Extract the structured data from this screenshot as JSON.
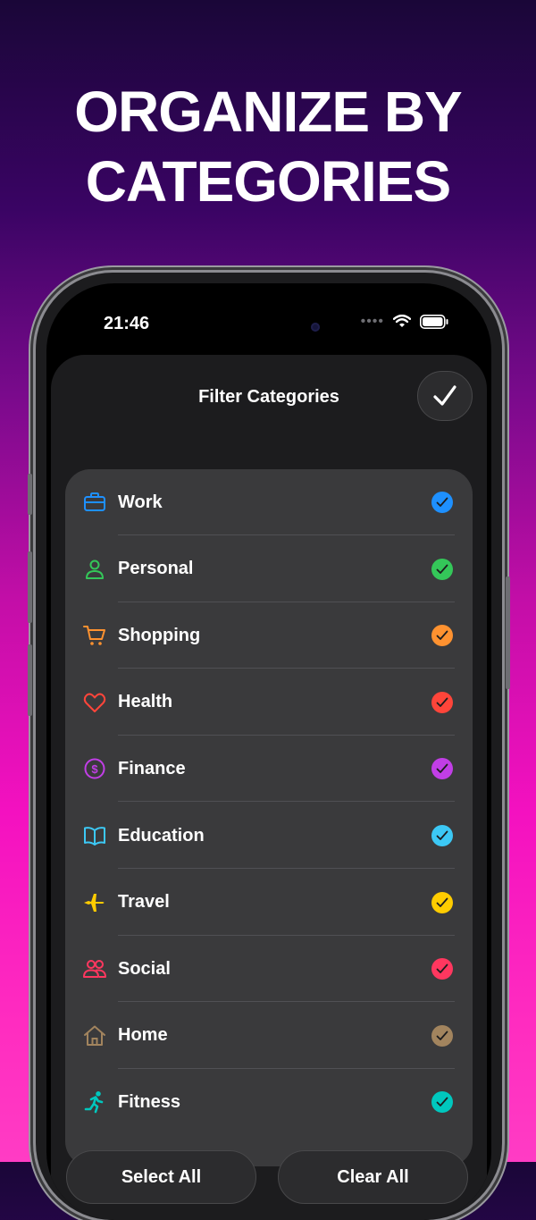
{
  "headline": {
    "line1": "ORGANIZE BY",
    "line2": "CATEGORIES"
  },
  "status_bar": {
    "time": "21:46",
    "icons": [
      "wifi-icon",
      "battery-icon"
    ]
  },
  "sheet": {
    "title": "Filter Categories",
    "done_icon": "checkmark-icon"
  },
  "categories": [
    {
      "label": "Work",
      "icon": "briefcase-icon",
      "color": "#1e90ff",
      "checked": true
    },
    {
      "label": "Personal",
      "icon": "person-icon",
      "color": "#34c759",
      "checked": true
    },
    {
      "label": "Shopping",
      "icon": "cart-icon",
      "color": "#ff9230",
      "checked": true
    },
    {
      "label": "Health",
      "icon": "heart-icon",
      "color": "#ff453a",
      "checked": true
    },
    {
      "label": "Finance",
      "icon": "dollar-circle-icon",
      "color": "#c13ee6",
      "checked": true
    },
    {
      "label": "Education",
      "icon": "book-icon",
      "color": "#3cc8f5",
      "checked": true
    },
    {
      "label": "Travel",
      "icon": "airplane-icon",
      "color": "#ffcc00",
      "checked": true
    },
    {
      "label": "Social",
      "icon": "people-icon",
      "color": "#ff375f",
      "checked": true
    },
    {
      "label": "Home",
      "icon": "house-icon",
      "color": "#a2845e",
      "checked": true
    },
    {
      "label": "Fitness",
      "icon": "runner-icon",
      "color": "#00c7be",
      "checked": true
    }
  ],
  "actions": {
    "select_all": "Select All",
    "clear_all": "Clear All"
  },
  "colors": {
    "accent": "#ff2cc0",
    "sheet": "#1c1c1e",
    "list": "#3a3a3c"
  }
}
